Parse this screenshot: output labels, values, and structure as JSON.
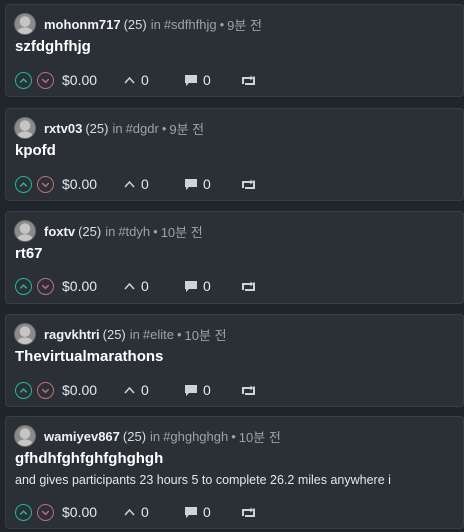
{
  "posts": [
    {
      "author": "mohonm717",
      "reputation": "(25)",
      "in_label": "in",
      "community": "#sdfhfhjg",
      "separator": "•",
      "time": "9분 전",
      "title": "szfdghfhjg",
      "excerpt": "",
      "payout": "$0.00",
      "votes": "0",
      "comments": "0"
    },
    {
      "author": "rxtv03",
      "reputation": "(25)",
      "in_label": "in",
      "community": "#dgdr",
      "separator": "•",
      "time": "9분 전",
      "title": "kpofd",
      "excerpt": "",
      "payout": "$0.00",
      "votes": "0",
      "comments": "0"
    },
    {
      "author": "foxtv",
      "reputation": "(25)",
      "in_label": "in",
      "community": "#tdyh",
      "separator": "•",
      "time": "10분 전",
      "title": "rt67",
      "excerpt": "",
      "payout": "$0.00",
      "votes": "0",
      "comments": "0"
    },
    {
      "author": "ragvkhtri",
      "reputation": "(25)",
      "in_label": "in",
      "community": "#elite",
      "separator": "•",
      "time": "10분 전",
      "title": "Thevirtualmarathons",
      "excerpt": "",
      "payout": "$0.00",
      "votes": "0",
      "comments": "0"
    },
    {
      "author": "wamiyev867",
      "reputation": "(25)",
      "in_label": "in",
      "community": "#ghghghgh",
      "separator": "•",
      "time": "10분 전",
      "title": "gfhdhfghfghfghghgh",
      "excerpt": "and gives participants 23 hours 5 to complete 26.2 miles anywhere i",
      "payout": "$0.00",
      "votes": "0",
      "comments": "0"
    }
  ],
  "icons": {
    "upvote": "chevron-up-circle-icon",
    "downvote": "chevron-down-circle-icon",
    "voters": "caret-up-icon",
    "comments": "comment-icon",
    "reblog": "reblog-icon"
  },
  "colors": {
    "background": "#1f252b",
    "card": "#2b3036",
    "upvote": "#27b69a",
    "downvote": "#c0707a",
    "meta": "#9aa3ab"
  }
}
